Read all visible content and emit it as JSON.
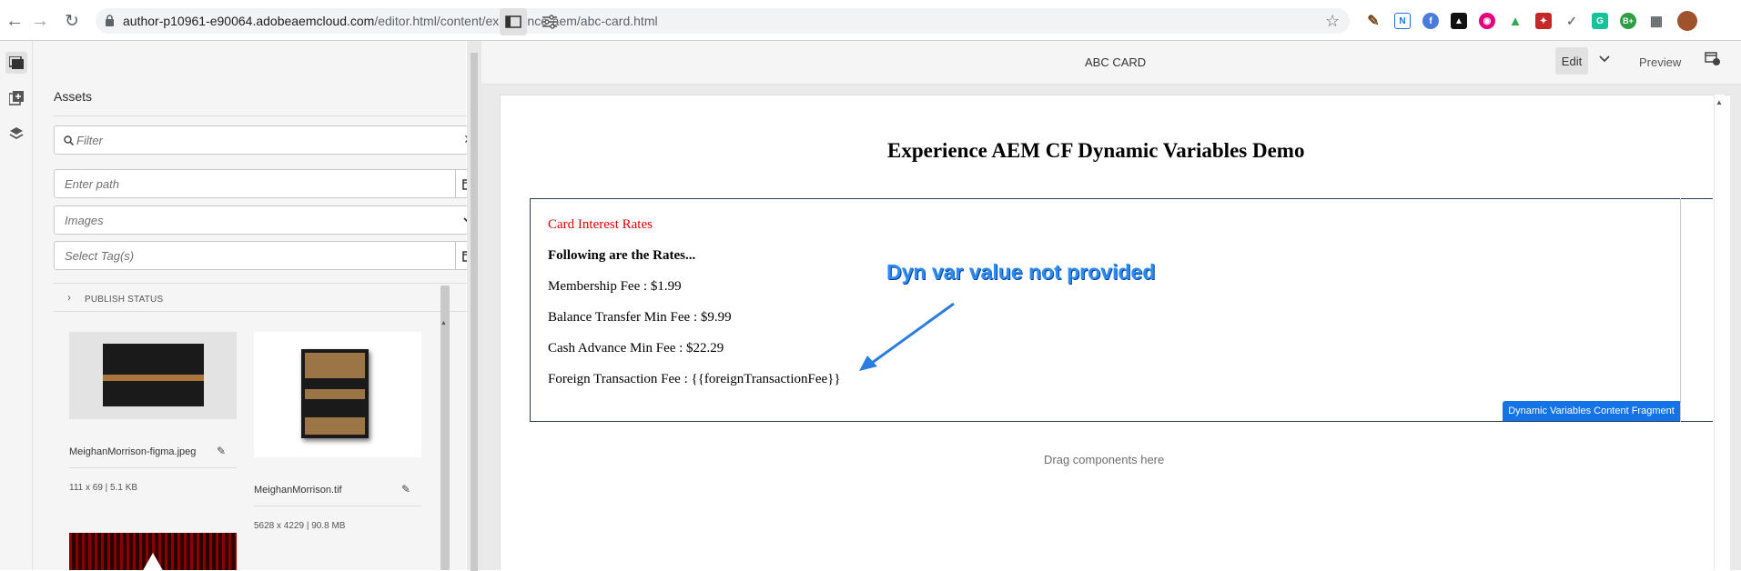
{
  "browser": {
    "url_host": "author-p10961-e90064.adobeaemcloud.com",
    "url_path": "/editor.html/content/experience-aem/abc-card.html",
    "icons": [
      "back-icon",
      "forward-icon",
      "reload-icon",
      "lock-icon",
      "star-icon",
      "puzzle-icon"
    ]
  },
  "panel": {
    "title": "Assets",
    "filter_placeholder": "Filter",
    "path_placeholder": "Enter path",
    "type_value": "Images",
    "tags_placeholder": "Select Tag(s)",
    "publish_status": "PUBLISH STATUS",
    "assets": [
      {
        "name": "MeighanMorrison-figma.jpeg",
        "meta": "111 x 69 | 5.1 KB"
      },
      {
        "name": "MeighanMorrison.tif",
        "meta": "5628 x 4229 | 90.8 MB"
      }
    ]
  },
  "toolbar": {
    "title": "ABC CARD",
    "edit_label": "Edit",
    "preview_label": "Preview"
  },
  "page": {
    "heading": "Experience AEM CF Dynamic Variables Demo",
    "rates_title": "Card Interest Rates",
    "rates_intro": "Following are the Rates...",
    "membership": "Membership Fee : $1.99",
    "balance_transfer": "Balance Transfer Min Fee : $9.99",
    "cash_advance": "Cash Advance Min Fee : $22.29",
    "foreign": "Foreign Transaction Fee : {{foreignTransactionFee}}",
    "cf_badge": "Dynamic Variables Content Fragment",
    "drag_here": "Drag components here"
  },
  "annotation": {
    "text": "Dyn var value not provided",
    "color": "#2b8cf5"
  },
  "colors": {
    "accent": "#1473e6",
    "rates_title": "#e00000"
  }
}
